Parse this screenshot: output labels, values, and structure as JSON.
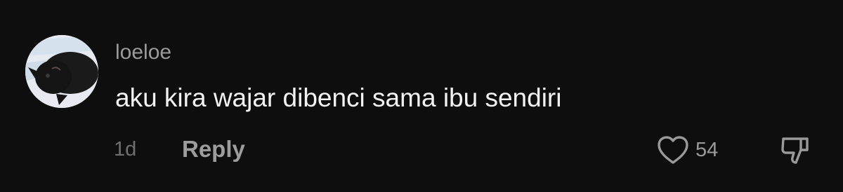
{
  "comment": {
    "avatar_icon": "black-cat-avatar",
    "username": "loeloe",
    "text": "aku kira wajar dibenci sama ibu sendiri",
    "timestamp": "1d",
    "reply_label": "Reply",
    "like_icon": "heart-outline-icon",
    "like_count": "54",
    "dislike_icon": "thumbs-down-icon"
  },
  "colors": {
    "background": "#0e0e0e",
    "username": "#9a9a9a",
    "text": "#f2f2f2",
    "muted": "#6f6f6f"
  }
}
